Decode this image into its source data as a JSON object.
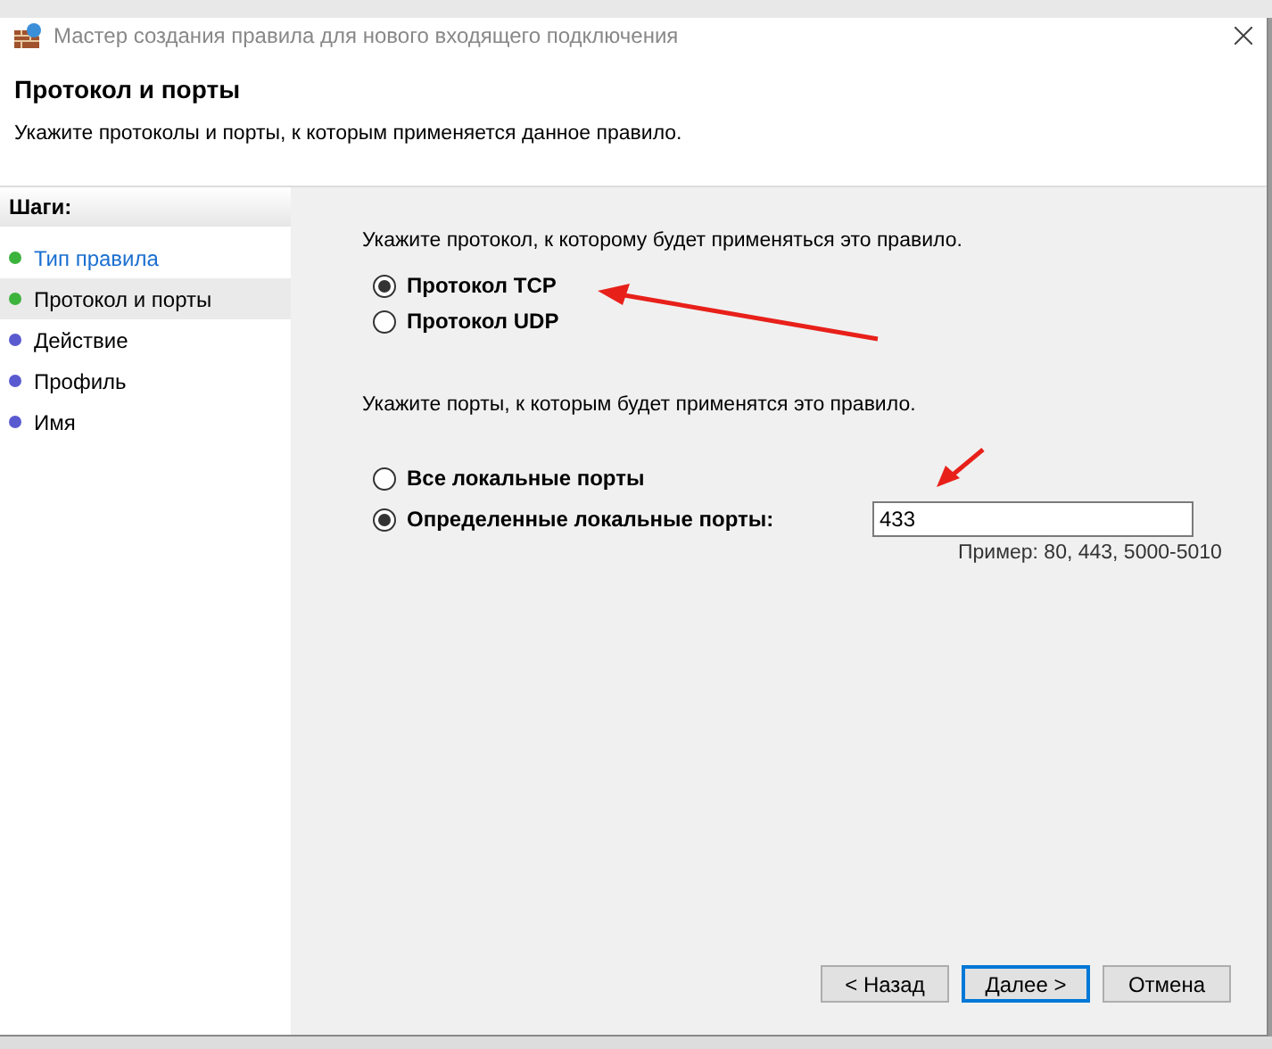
{
  "window": {
    "title": "Мастер создания правила для нового входящего подключения"
  },
  "header": {
    "title": "Протокол и порты",
    "subtitle": "Укажите протоколы и порты, к которым применяется данное правило."
  },
  "steps": {
    "title": "Шаги:",
    "items": [
      {
        "label": "Тип правила",
        "selected": false,
        "kind": "link",
        "color": "#3cb33c"
      },
      {
        "label": "Протокол и порты",
        "selected": true,
        "kind": "plain",
        "color": "#3cb33c"
      },
      {
        "label": "Действие",
        "selected": false,
        "kind": "plain",
        "color": "#5a5ad0"
      },
      {
        "label": "Профиль",
        "selected": false,
        "kind": "plain",
        "color": "#5a5ad0"
      },
      {
        "label": "Имя",
        "selected": false,
        "kind": "plain",
        "color": "#5a5ad0"
      }
    ]
  },
  "protocol": {
    "prompt": "Укажите протокол, к которому будет применяться это правило.",
    "options": [
      {
        "label": "Протокол TCP",
        "selected": true
      },
      {
        "label": "Протокол UDP",
        "selected": false
      }
    ]
  },
  "ports": {
    "prompt": "Укажите порты, к которым будет применятся это правило.",
    "options": [
      {
        "label": "Все локальные порты",
        "selected": false
      },
      {
        "label": "Определенные локальные порты:",
        "selected": true
      }
    ],
    "value": "433",
    "example": "Пример: 80, 443, 5000-5010"
  },
  "buttons": [
    {
      "label": "< Назад",
      "focused": false
    },
    {
      "label": "Далее >",
      "focused": true
    },
    {
      "label": "Отмена",
      "focused": false
    }
  ]
}
